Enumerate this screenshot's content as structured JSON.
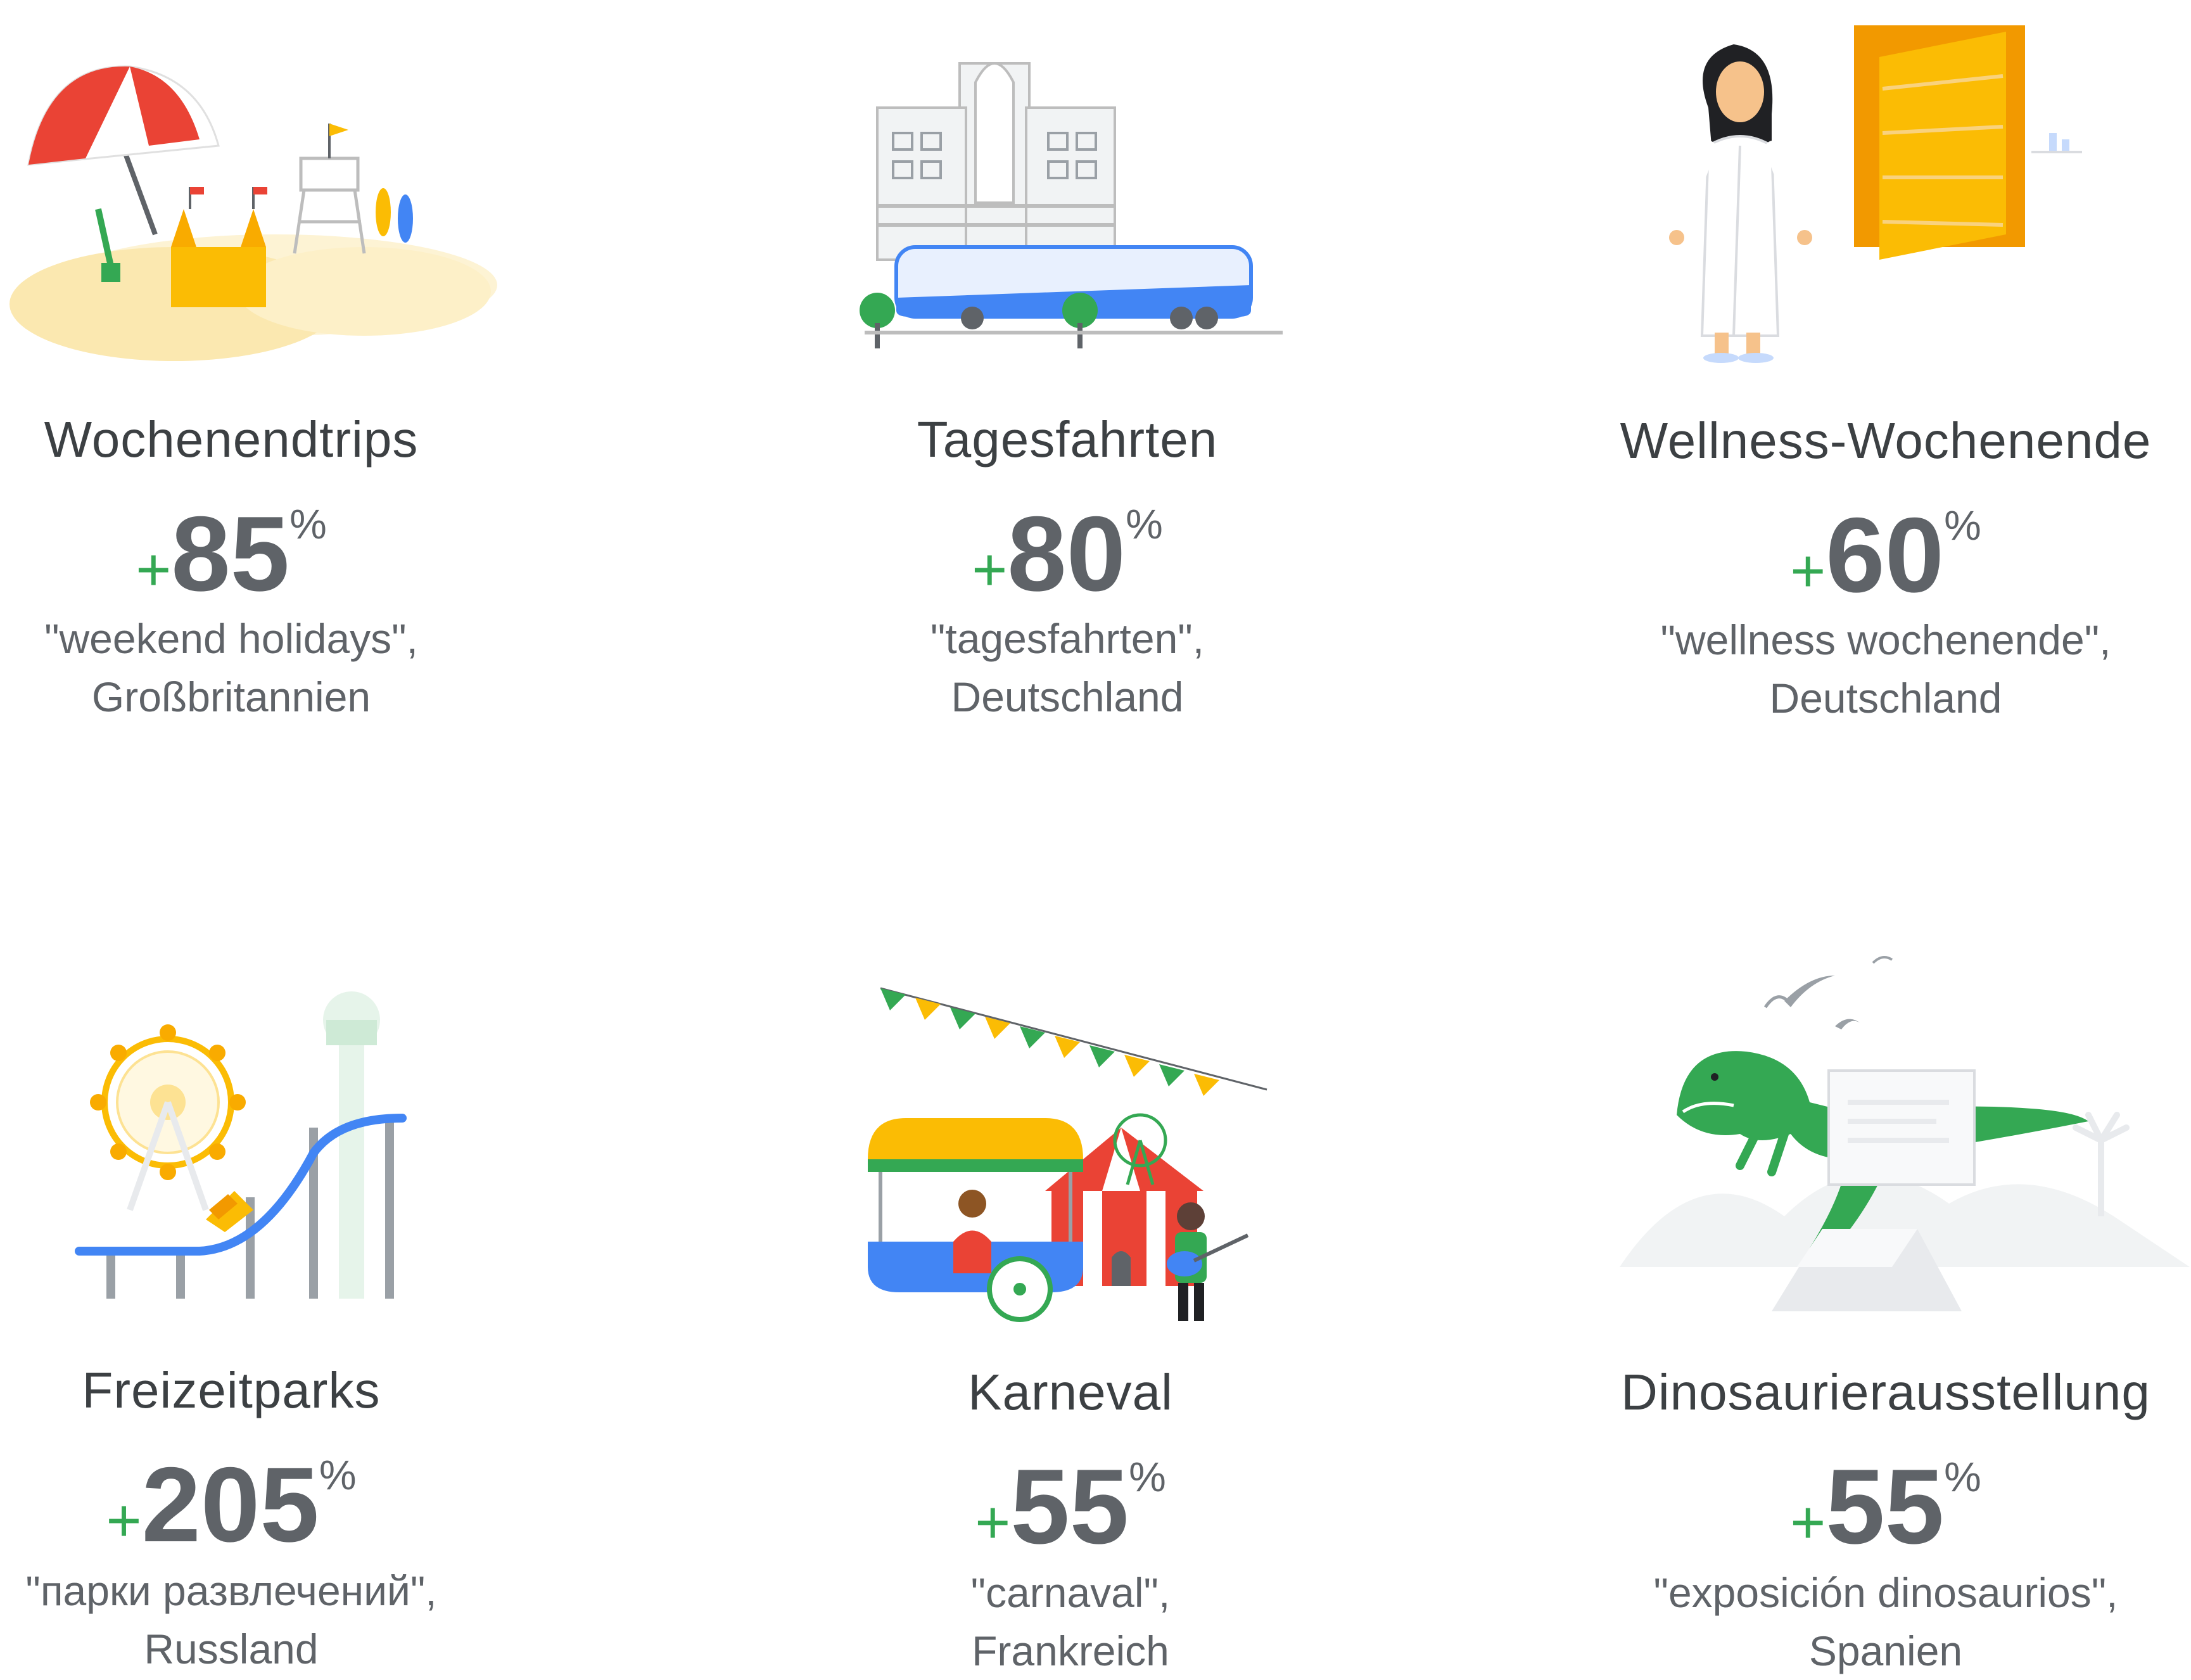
{
  "colors": {
    "text_title": "#3c4043",
    "text_body": "#5f6368",
    "accent_plus": "#34a853",
    "google_blue": "#4285f4",
    "google_red": "#ea4335",
    "google_yellow": "#fbbc04",
    "google_green": "#34a853"
  },
  "cards": [
    {
      "illustration": "beach-sandcastle-illustration",
      "title": "Wochenendtrips",
      "plus": "+",
      "value": "85",
      "unit": "%",
      "query": "\"weekend holidays\",",
      "country": "Großbritannien"
    },
    {
      "illustration": "bus-station-illustration",
      "title": "Tagesfahrten",
      "plus": "+",
      "value": "80",
      "unit": "%",
      "query": "\"tagesfahrten\",",
      "country": "Deutschland"
    },
    {
      "illustration": "spa-woman-bathrobe-illustration",
      "title": "Wellness-Wochenende",
      "plus": "+",
      "value": "60",
      "unit": "%",
      "query": "\"wellness wochenende\",",
      "country": "Deutschland"
    },
    {
      "illustration": "amusement-park-illustration",
      "title": "Freizeitparks",
      "plus": "+",
      "value": "205",
      "unit": "%",
      "query": "\"парки развлечений\",",
      "country": "Russland"
    },
    {
      "illustration": "carnival-circus-illustration",
      "title": "Karneval",
      "plus": "+",
      "value": "55",
      "unit": "%",
      "query": "\"carnaval\",",
      "country": "Frankreich"
    },
    {
      "illustration": "dinosaur-exhibition-illustration",
      "title": "Dinosaurierausstellung",
      "plus": "+",
      "value": "55",
      "unit": "%",
      "query": "\"exposición dinosaurios\",",
      "country": "Spanien"
    }
  ]
}
